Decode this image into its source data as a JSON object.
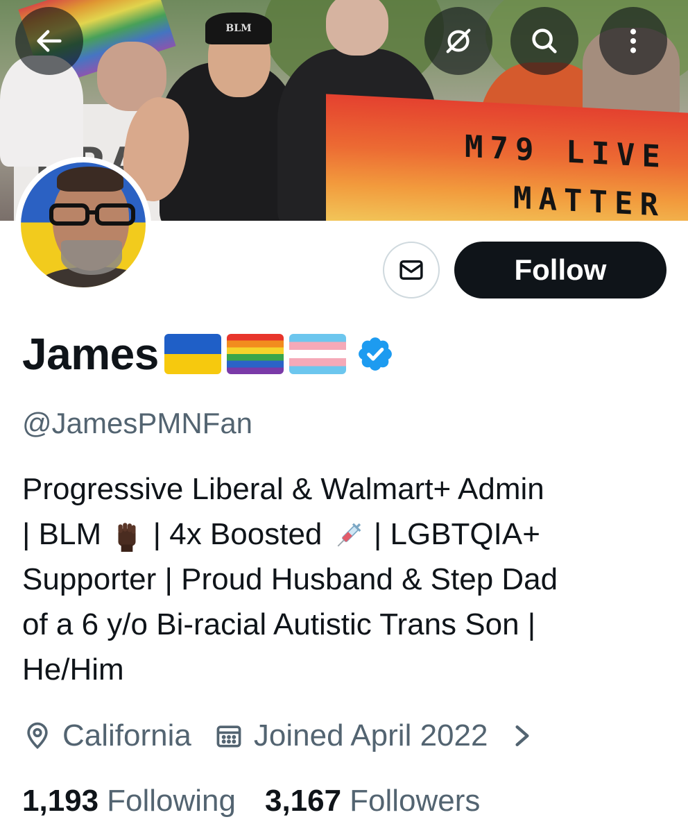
{
  "header": {
    "back_icon": "arrow-left-icon",
    "grok_icon": "grok-icon",
    "search_icon": "search-icon",
    "more_icon": "more-vertical-icon"
  },
  "banner": {
    "hat_text": "BLM",
    "sign_text": "ПРА",
    "banner_line1": "M79 LIVE",
    "banner_line2": "MATTER"
  },
  "profile": {
    "display_name": "James",
    "name_emojis": [
      "ukraine-flag",
      "rainbow-flag",
      "transgender-flag"
    ],
    "verified": true,
    "handle": "@JamesPMNFan",
    "bio_lines": [
      [
        "Progressive Liberal & Walmart+ Admin"
      ],
      [
        "| BLM ",
        " | 4x Boosted ",
        " | LGBTQIA+"
      ],
      [
        "Supporter | Proud Husband & Step Dad"
      ],
      [
        "of a 6 y/o Bi-racial Autistic Trans Son |"
      ],
      [
        "He/Him"
      ]
    ],
    "location": "California",
    "joined": "Joined April 2022",
    "following_count": "1,193",
    "following_label": "Following",
    "followers_count": "3,167",
    "followers_label": "Followers"
  },
  "actions": {
    "message_icon": "envelope-icon",
    "follow_label": "Follow"
  },
  "colors": {
    "text_primary": "#0f1419",
    "text_secondary": "#536471",
    "verified_blue": "#1d9bf0",
    "follow_bg": "#0f1419",
    "border": "#cfd9de"
  }
}
